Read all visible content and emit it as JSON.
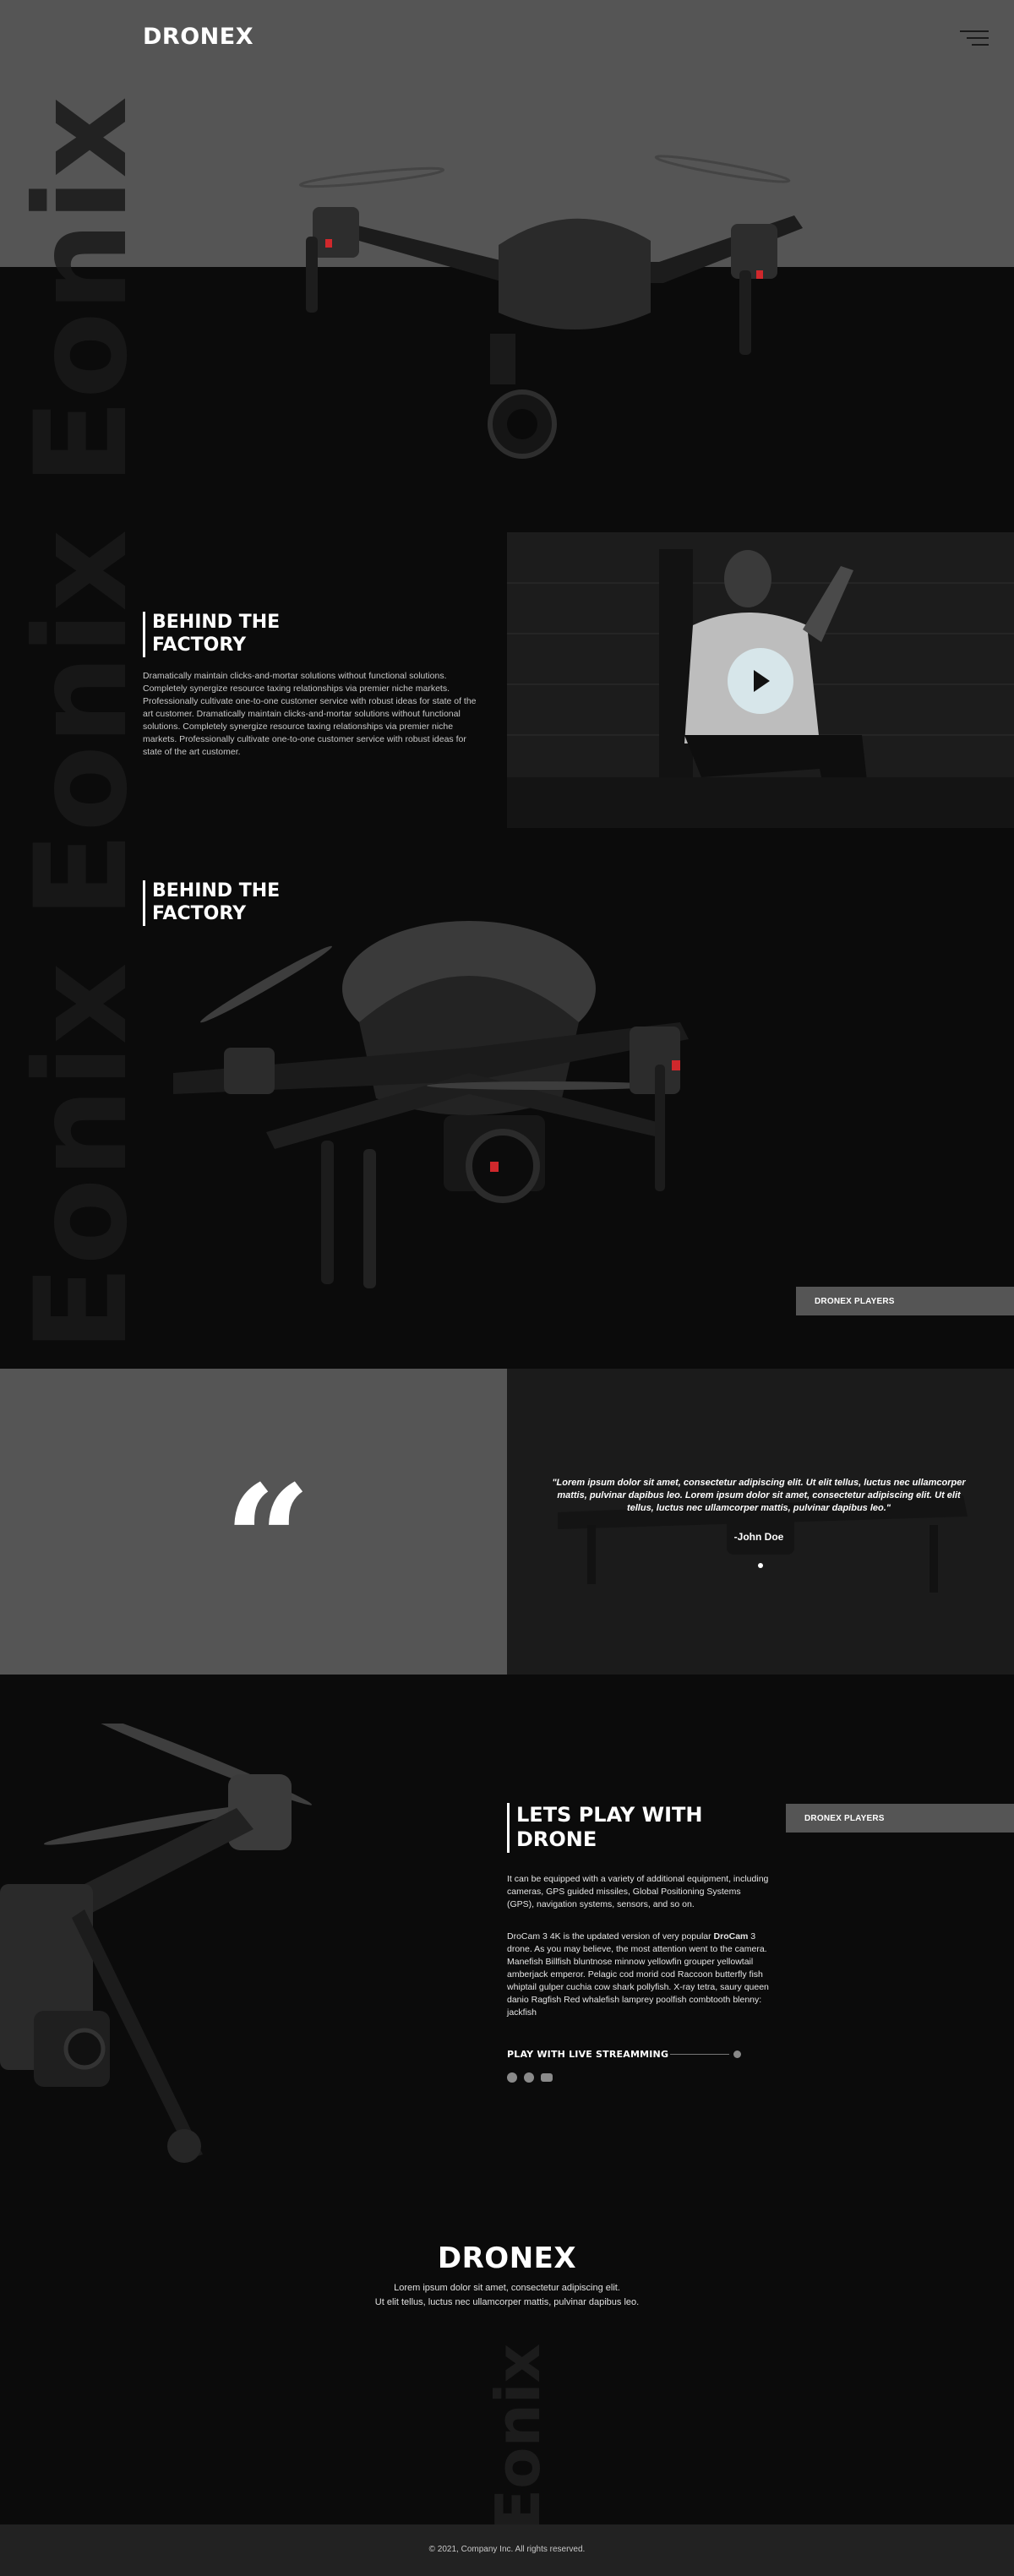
{
  "brand": "DRONEX",
  "watermark": "Eonix",
  "colors": {
    "band": "#555555",
    "background": "#0b0b0b",
    "text": "#ffffff",
    "play_button": "#d7e6ea"
  },
  "header": {
    "logo": "DRONEX",
    "menu_icon": "hamburger-icon"
  },
  "factory": {
    "title_line1": "BEHIND THE",
    "title_line2": "FACTORY",
    "body": "Dramatically maintain clicks-and-mortar solutions without functional solutions. Completely synergize resource taxing relationships via premier niche markets. Professionally cultivate one-to-one customer service with robust ideas for state of the art customer. Dramatically maintain clicks-and-mortar solutions without functional solutions. Completely synergize resource taxing relationships via premier niche markets. Professionally cultivate one-to-one customer service with robust ideas for state of the art customer.",
    "play_icon": "play-icon"
  },
  "factory2": {
    "title_line1": "BEHIND THE",
    "title_line2": "FACTORY",
    "button": "DRONEX PLAYERS"
  },
  "testimonial": {
    "quote_mark": "“",
    "text": "\"Lorem ipsum dolor sit amet, consectetur adipiscing elit. Ut elit tellus, luctus nec ullamcorper mattis, pulvinar dapibus leo. Lorem ipsum dolor sit amet, consectetur adipiscing elit. Ut elit tellus, luctus nec ullamcorper mattis, pulvinar dapibus leo.\"",
    "author": "-John Doe"
  },
  "play": {
    "title_line1": "LETS PLAY WITH",
    "title_line2": "DRONE",
    "button": "DRONEX PLAYERS",
    "p1": "It can be equipped with a variety of additional equipment, including cameras, GPS guided missiles, Global Positioning Systems (GPS), navigation systems, sensors, and so on.",
    "p2_before": "DroCam 3 4K is the updated version of very popular ",
    "p2_bold": "DroCam",
    "p2_after": " 3 drone. As you may believe, the most attention went to the camera. Manefish Billfish bluntnose minnow yellowfin grouper yellowtail amberjack emperor. Pelagic cod morid cod Raccoon butterfly fish whiptail gulper cuchia cow shark pollyfish. X-ray tetra, saury queen danio Ragfish Red whalefish lamprey poolfish combtooth blenny: jackfish",
    "live": "PLAY WITH LIVE STREAMMING",
    "social_icons": [
      "facebook-icon",
      "instagram-icon",
      "youtube-icon"
    ]
  },
  "footer": {
    "brand": "DRONEX",
    "line1": "Lorem ipsum dolor sit amet, consectetur adipiscing elit.",
    "line2": "Ut elit tellus, luctus nec ullamcorper mattis, pulvinar dapibus leo.",
    "copyright": "© 2021, Company Inc. All rights reserved."
  }
}
